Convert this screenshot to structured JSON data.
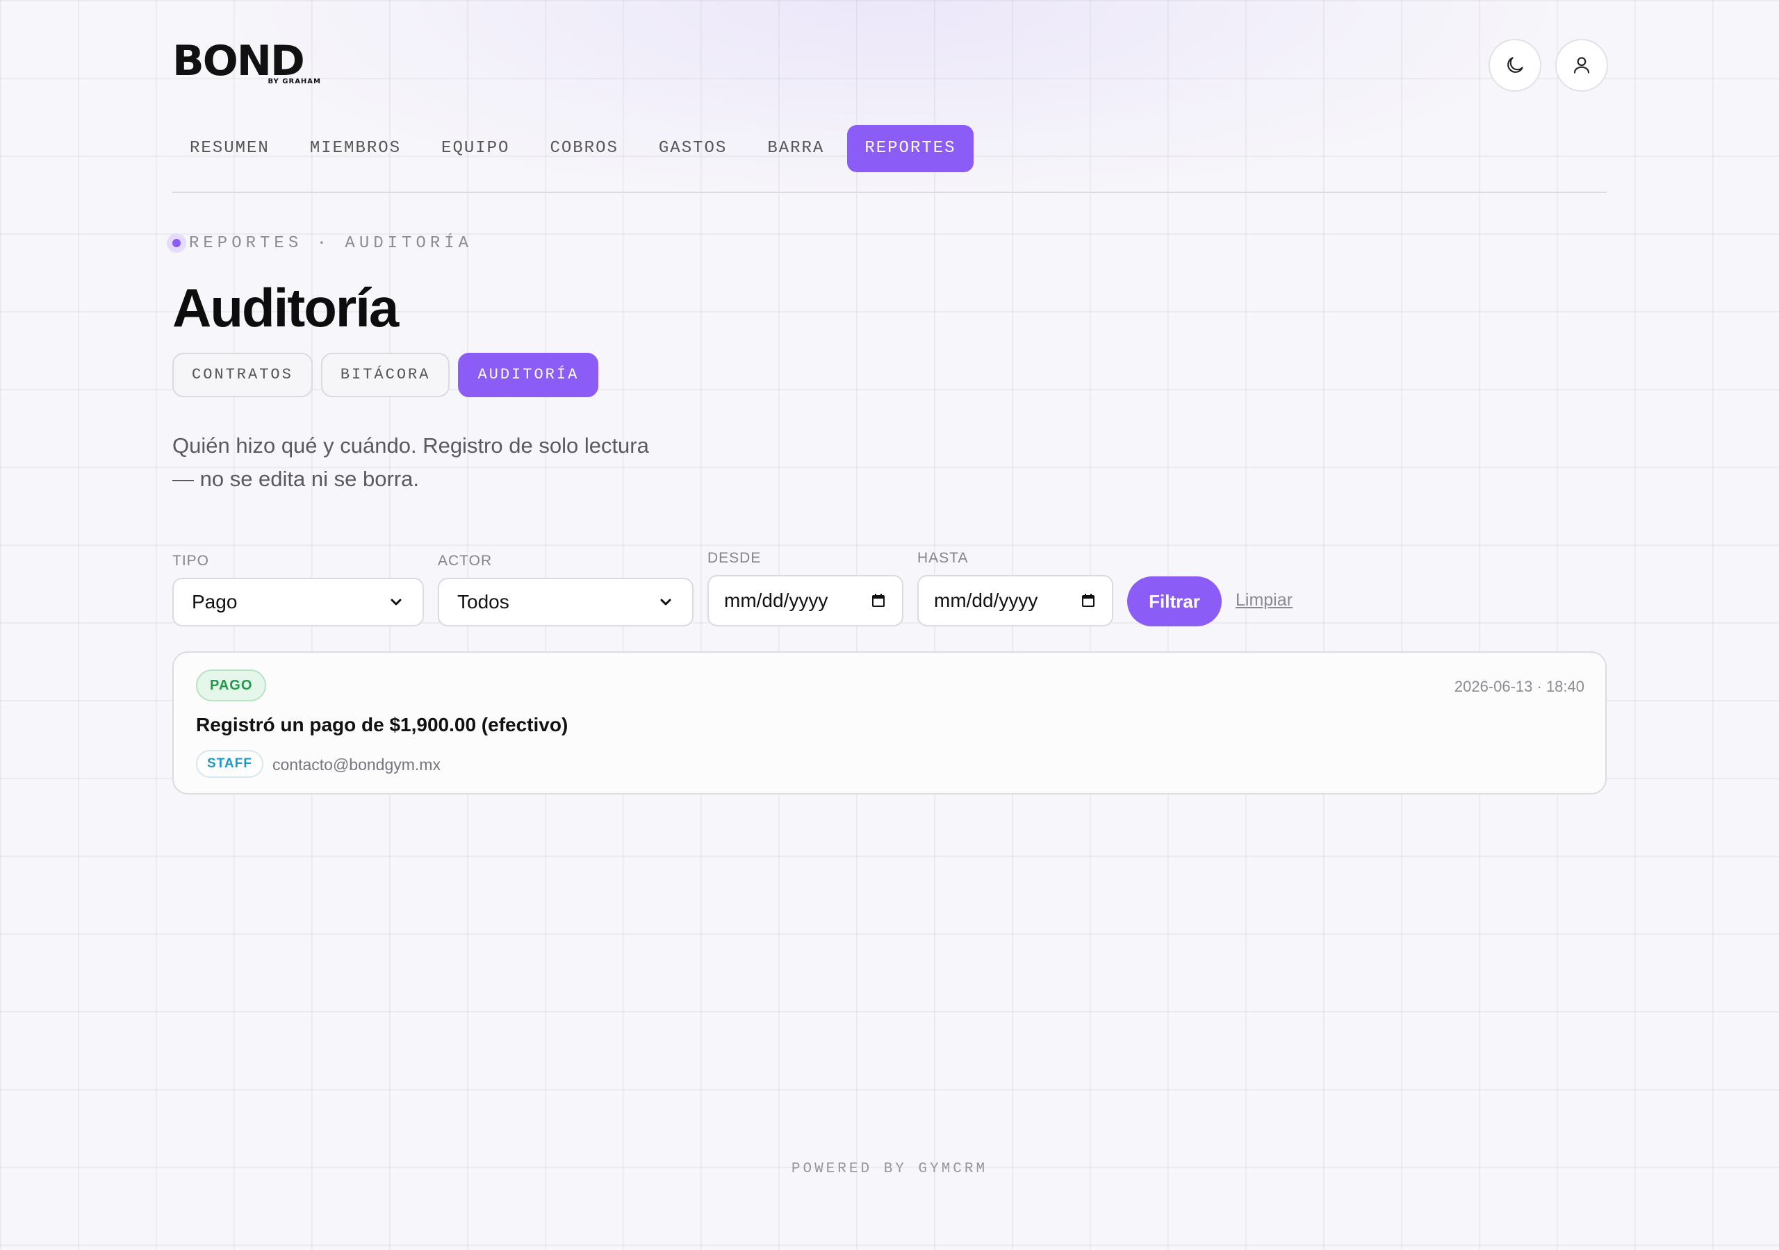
{
  "brand": {
    "logo_text": "BOND",
    "logo_sub": "BY GRAHAM"
  },
  "header": {
    "theme_icon": "moon-icon",
    "user_icon": "user-icon"
  },
  "nav": {
    "items": [
      {
        "label": "RESUMEN"
      },
      {
        "label": "MIEMBROS"
      },
      {
        "label": "EQUIPO"
      },
      {
        "label": "COBROS"
      },
      {
        "label": "GASTOS"
      },
      {
        "label": "BARRA"
      },
      {
        "label": "REPORTES"
      }
    ],
    "active": "REPORTES"
  },
  "breadcrumb": {
    "text": "REPORTES · AUDITORÍA"
  },
  "page": {
    "title": "Auditoría",
    "description": "Quién hizo qué y cuándo. Registro de solo lectura — no se edita ni se borra."
  },
  "tabs": [
    {
      "label": "CONTRATOS"
    },
    {
      "label": "BITÁCORA"
    },
    {
      "label": "AUDITORÍA"
    }
  ],
  "filters": {
    "tipo": {
      "label": "TIPO",
      "value": "Pago"
    },
    "actor": {
      "label": "ACTOR",
      "value": "Todos"
    },
    "desde": {
      "label": "DESDE",
      "placeholder": "mm/dd/yyyy"
    },
    "hasta": {
      "label": "HASTA",
      "placeholder": "mm/dd/yyyy"
    },
    "submit_label": "Filtrar",
    "clear_label": "Limpiar"
  },
  "entries": [
    {
      "type": "PAGO",
      "timestamp": "2026-06-13 · 18:40",
      "message": "Registró un pago de $1,900.00 (efectivo)",
      "role": "STAFF",
      "actor": "contacto@bondgym.mx"
    }
  ],
  "footer": {
    "text": "POWERED BY GYMCRM"
  },
  "colors": {
    "accent": "#8b5cf6",
    "success": "#1f9a4b",
    "info": "#1b9ac4"
  }
}
